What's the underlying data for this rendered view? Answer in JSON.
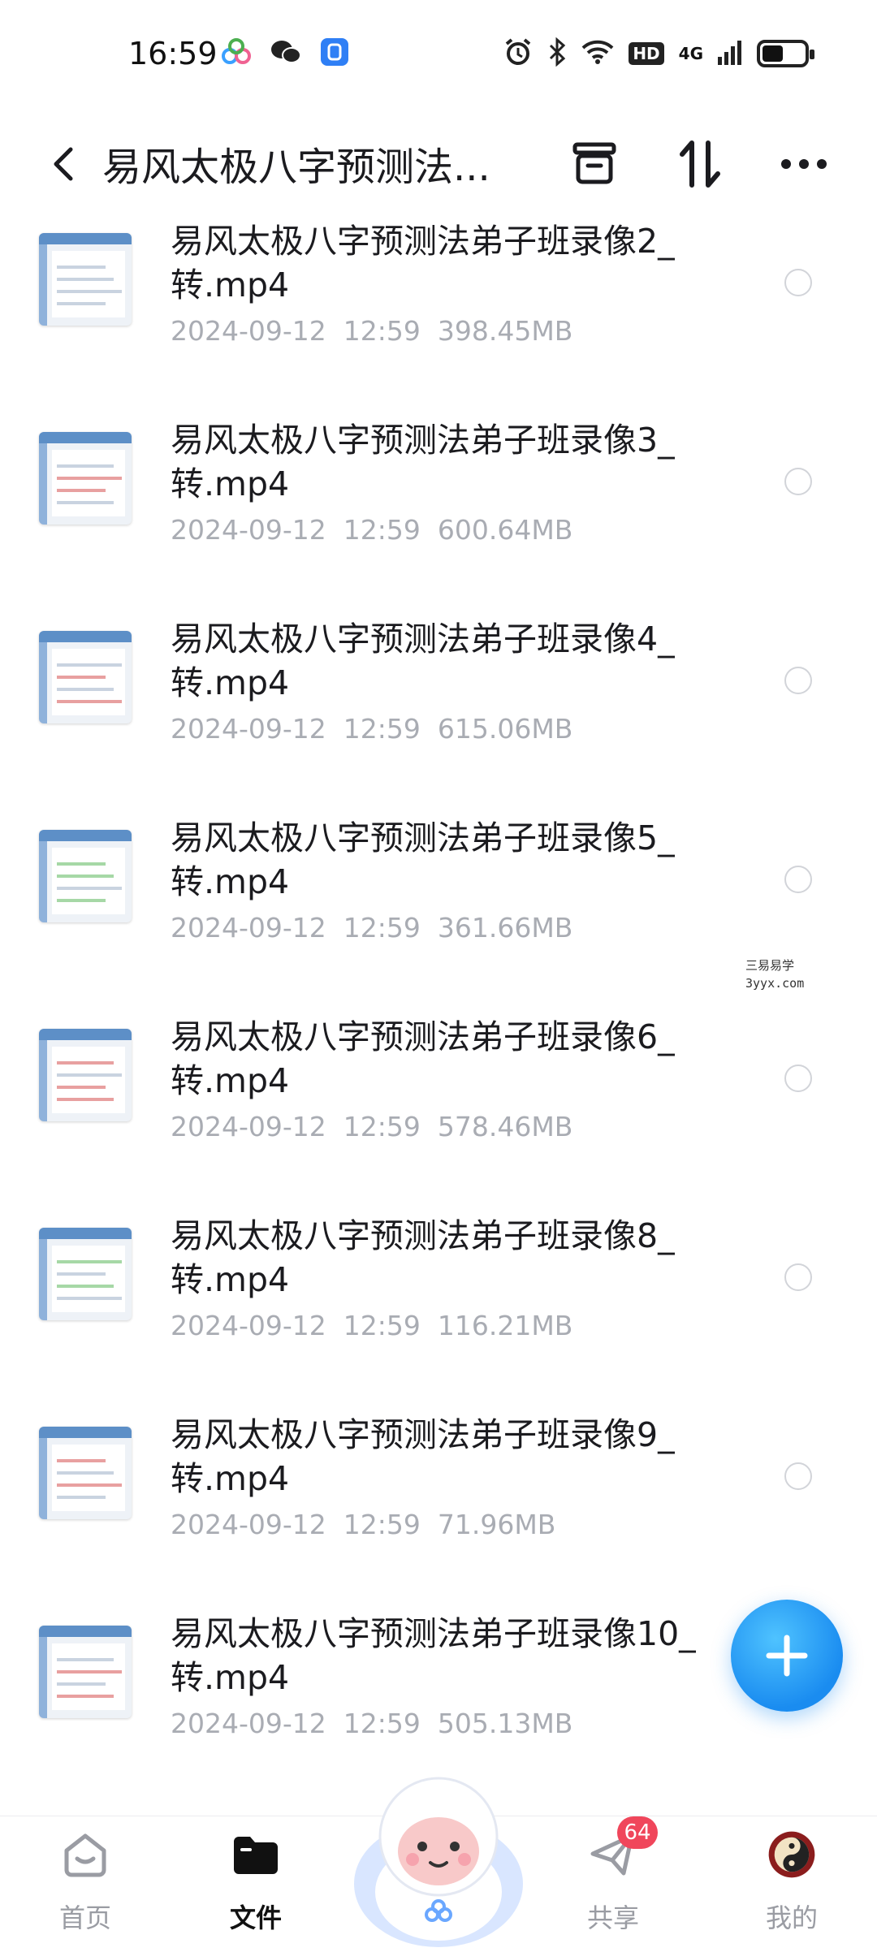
{
  "status_bar": {
    "time": "16:59",
    "network_label": "HD",
    "signal_label": "4G",
    "battery_level": 0.44
  },
  "header": {
    "back_icon": "chevron-left-icon",
    "title": "易风太极八字预测法...",
    "archive_icon": "archive-box-icon",
    "sort_icon": "sort-icon",
    "more_icon": "more-dots-icon"
  },
  "files": [
    {
      "name": "易风太极八字预测法弟子班录像2_转.mp4",
      "date": "2024-09-12",
      "time": "12:59",
      "size": "398.45MB"
    },
    {
      "name": "易风太极八字预测法弟子班录像3_转.mp4",
      "date": "2024-09-12",
      "time": "12:59",
      "size": "600.64MB"
    },
    {
      "name": "易风太极八字预测法弟子班录像4_转.mp4",
      "date": "2024-09-12",
      "time": "12:59",
      "size": "615.06MB"
    },
    {
      "name": "易风太极八字预测法弟子班录像5_转.mp4",
      "date": "2024-09-12",
      "time": "12:59",
      "size": "361.66MB"
    },
    {
      "name": "易风太极八字预测法弟子班录像6_转.mp4",
      "date": "2024-09-12",
      "time": "12:59",
      "size": "578.46MB"
    },
    {
      "name": "易风太极八字预测法弟子班录像8_转.mp4",
      "date": "2024-09-12",
      "time": "12:59",
      "size": "116.21MB"
    },
    {
      "name": "易风太极八字预测法弟子班录像9_转.mp4",
      "date": "2024-09-12",
      "time": "12:59",
      "size": "71.96MB"
    },
    {
      "name": "易风太极八字预测法弟子班录像10_转.mp4",
      "date": "2024-09-12",
      "time": "12:59",
      "size": "505.13MB"
    }
  ],
  "watermark": {
    "line1": "三易易学",
    "line2": "3yyx.com"
  },
  "fab": {
    "icon": "plus-icon",
    "color": "#1a8cf0"
  },
  "bottom_nav": {
    "items": [
      {
        "label": "首页",
        "icon": "home-icon"
      },
      {
        "label": "文件",
        "icon": "folder-icon"
      },
      {
        "label": "共享",
        "icon": "send-icon",
        "badge": "64"
      },
      {
        "label": "我的",
        "icon": "avatar-icon"
      }
    ]
  },
  "colors": {
    "accent": "#1a8cf0",
    "meta_text": "#a9acb3",
    "badge": "#f0465b"
  }
}
